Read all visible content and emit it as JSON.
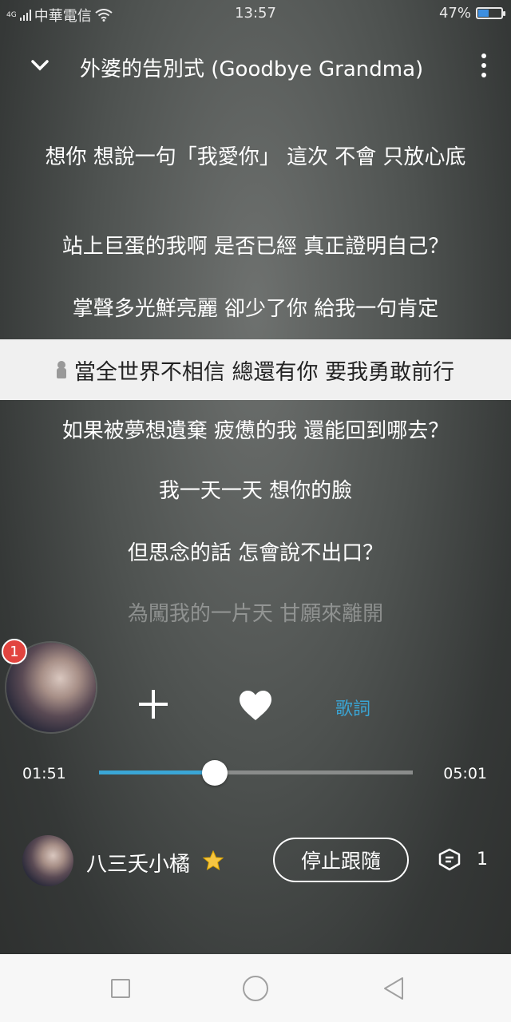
{
  "status_bar": {
    "network": "4G",
    "carrier": "中華電信",
    "time": "13:57",
    "battery_percent": "47%",
    "battery_level": 0.47,
    "accent_color": "#3d8fe0"
  },
  "header": {
    "title": "外婆的告別式 (Goodbye Grandma)",
    "collapse_icon": "chevron-down-icon",
    "menu_icon": "more-vertical-icon"
  },
  "lyrics": {
    "lines": [
      "想你 想說一句「我愛你」 這次 不會 只放心底",
      "站上巨蛋的我啊 是否已經 真正證明自己？",
      "掌聲多光鮮亮麗 卻少了你 給我一句肯定",
      "當全世界不相信 總還有你 要我勇敢前行",
      "如果被夢想遺棄 疲憊的我 還能回到哪去？",
      "我一天一天 想你的臉",
      "但思念的話 怎會說不出口？",
      "為闖我的一片天 甘願來離開"
    ],
    "active_index": 3
  },
  "player": {
    "notification_count": "1",
    "lyrics_tab_label": "歌詞",
    "accent_color": "#3aa6d6",
    "current_time": "01:51",
    "total_time": "05:01",
    "progress_fraction": 0.369
  },
  "user": {
    "name": "八三夭小橘",
    "unfollow_label": "停止跟隨",
    "comment_count": "1"
  }
}
